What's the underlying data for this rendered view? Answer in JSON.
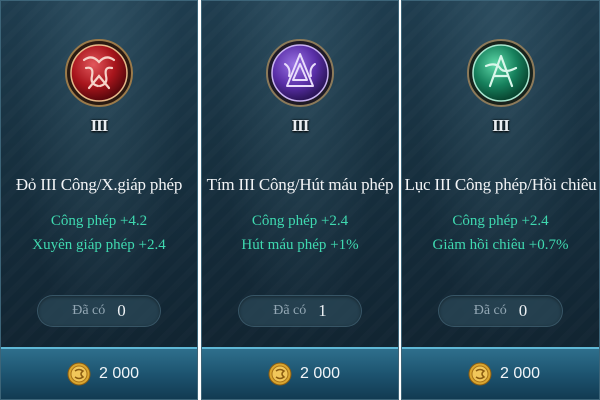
{
  "cards": [
    {
      "tier": "III",
      "title": "Đỏ III Công/X.giáp phép",
      "stat1": "Công phép +4.2",
      "stat2": "Xuyên giáp phép +2.4",
      "owned_label": "Đã có",
      "owned_count": "0",
      "price": "2 000",
      "gem_color": "#c0272d"
    },
    {
      "tier": "III",
      "title": "Tím III Công/Hút máu phép",
      "stat1": "Công phép +2.4",
      "stat2": "Hút máu phép +1%",
      "owned_label": "Đã có",
      "owned_count": "1",
      "price": "2 000",
      "gem_color": "#6b3fb8"
    },
    {
      "tier": "III",
      "title": "Lục III Công phép/Hồi chiêu",
      "stat1": "Công phép +2.4",
      "stat2": "Giảm hồi chiêu +0.7%",
      "owned_label": "Đã có",
      "owned_count": "0",
      "price": "2 000",
      "gem_color": "#1f8f6a"
    }
  ],
  "icons": {
    "gem": "arcana-gem-icon",
    "coin": "gold-coin-icon"
  },
  "colors": {
    "stat_text": "#3fd9b0",
    "card_bg": "#17303f",
    "buy_bar": "#1d5470"
  }
}
